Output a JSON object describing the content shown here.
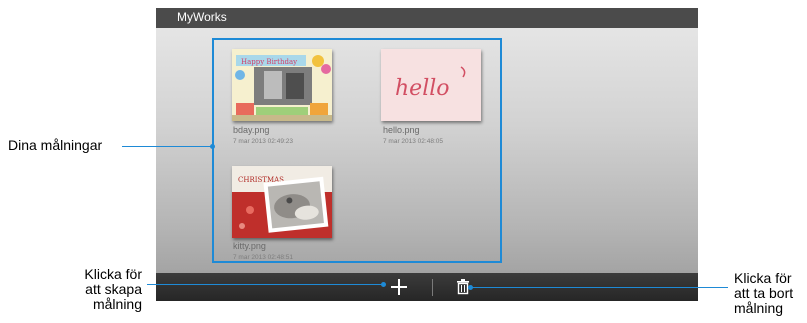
{
  "app": {
    "title": "MyWorks"
  },
  "works": [
    {
      "name": "bday.png",
      "date": "7 mar 2013 02:49:23",
      "thumb_text": "Happy Birthday"
    },
    {
      "name": "hello.png",
      "date": "7 mar 2013 02:48:05",
      "thumb_text": "hello"
    },
    {
      "name": "kitty.png",
      "date": "7 mar 2013 02:48:51",
      "thumb_text": "CHRISTMAS"
    }
  ],
  "toolbar": {
    "add_icon": "plus-icon",
    "delete_icon": "trash-icon"
  },
  "callouts": {
    "paintings": "Dina målningar",
    "create": [
      "Klicka för",
      "att skapa",
      "målning"
    ],
    "delete": [
      "Klicka för",
      "att ta bort",
      "målning"
    ]
  },
  "colors": {
    "accent": "#1e8ad6",
    "titlebar": "#4b4b4b",
    "bottombar": "#2e2e2e"
  }
}
